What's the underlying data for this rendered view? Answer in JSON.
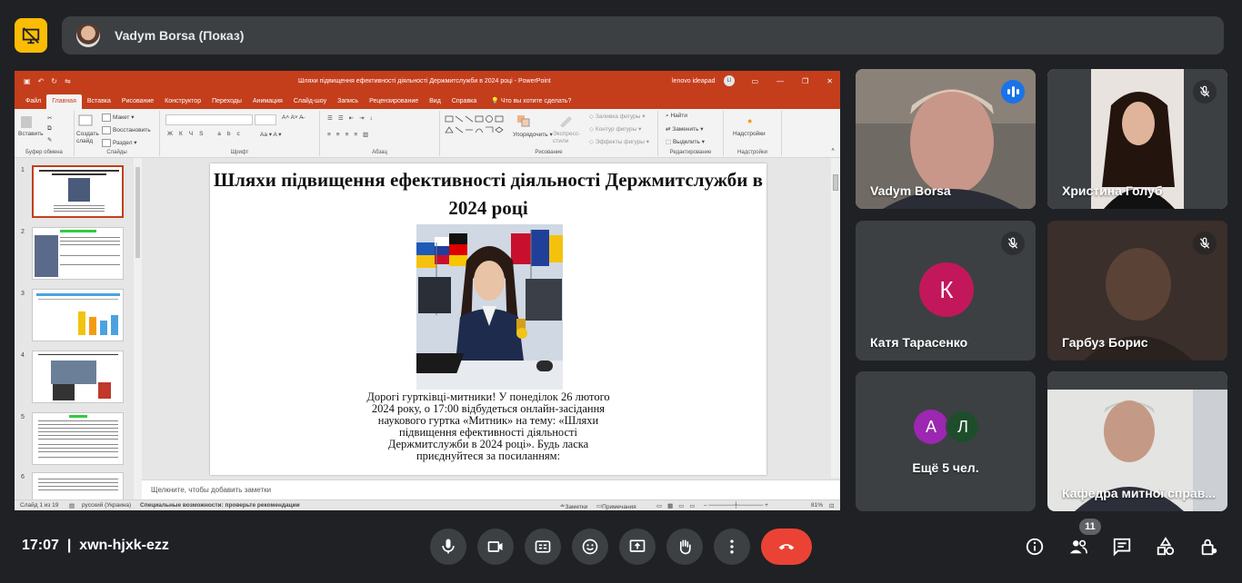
{
  "presenter": {
    "banner_title": "Vadym Borsa (Показ)"
  },
  "powerpoint": {
    "doc_title": "Шляхи підвищення ефективності діяльності Держмитслужби в 2024 році  -  PowerPoint",
    "user_name": "lenovo ideapad",
    "user_initial": "LI",
    "tabs": [
      "Файл",
      "Главная",
      "Вставка",
      "Рисование",
      "Конструктор",
      "Переходы",
      "Анимация",
      "Слайд-шоу",
      "Запись",
      "Рецензирование",
      "Вид",
      "Справка"
    ],
    "active_tab": "Главная",
    "tell_me": "Что вы хотите сделать?",
    "ribbon": {
      "paste": "Вставить",
      "clipboard_group": "Буфер обмена",
      "layout": "Макет",
      "restore": "Восстановить",
      "create_slide": "Создать слайд",
      "section": "Раздел",
      "slides_group": "Слайды",
      "font_group": "Шрифт",
      "paragraph_group": "Абзац",
      "arrange": "Упорядочить",
      "quick_styles": "Экспресс-стили",
      "shape_fill": "Заливка фигуры",
      "shape_outline": "Контур фигуры",
      "shape_effects": "Эффекты фигуры",
      "drawing_group": "Рисование",
      "find": "Найти",
      "replace": "Заменить",
      "select": "Выделить",
      "editing_group": "Редактирование",
      "addins": "Надстройки",
      "addins_group": "Надстройки"
    },
    "thumb_numbers": [
      "1",
      "2",
      "3",
      "4",
      "5",
      "6"
    ],
    "slide": {
      "title": "Шляхи підвищення ефективності діяльності Держмитслужби в 2024 році",
      "body": "Дорогі гуртківці-митники! У понеділок 26 лютого 2024 року, о 17:00 відбудеться онлайн-засідання наукового гуртка «Митник» на тему: «Шляхи підвищення ефективності діяльності Держмитслужби в 2024 році». Будь ласка приєднуйтеся за посиланням:"
    },
    "notes_placeholder": "Щелкните, чтобы добавить заметки",
    "status": {
      "slide_counter": "Слайд 1 из 19",
      "language": "русский (Украина)",
      "accessibility": "Специальные возможности: проверьте рекомендации",
      "notes_btn": "Заметки",
      "comments_btn": "Примечания",
      "zoom": "81%"
    }
  },
  "participants": [
    {
      "name": "Vadym Borsa",
      "speaking": true
    },
    {
      "name": "Христина Голуб",
      "muted": true
    },
    {
      "name": "Катя Тарасенко",
      "initial": "К",
      "avatar_color": "#c2185b",
      "muted": true
    },
    {
      "name": "Гарбуз Борис",
      "muted": true
    },
    {
      "name": "Ещё 5 чел.",
      "initials": [
        "А",
        "Л"
      ],
      "avatar_colors": [
        "#9c27b0",
        "#1e4d2b"
      ]
    },
    {
      "name": "Кафедра митної справ..."
    }
  ],
  "meeting": {
    "time": "17:07",
    "code": "xwn-hjxk-ezz",
    "participant_count": "11"
  },
  "colors": {
    "background": "#202124",
    "tile": "#3c4043",
    "accent_blue": "#8ab4f8",
    "end_call": "#ea4335",
    "present_icon": "#fbbc04",
    "powerpoint": "#c43e1c"
  }
}
